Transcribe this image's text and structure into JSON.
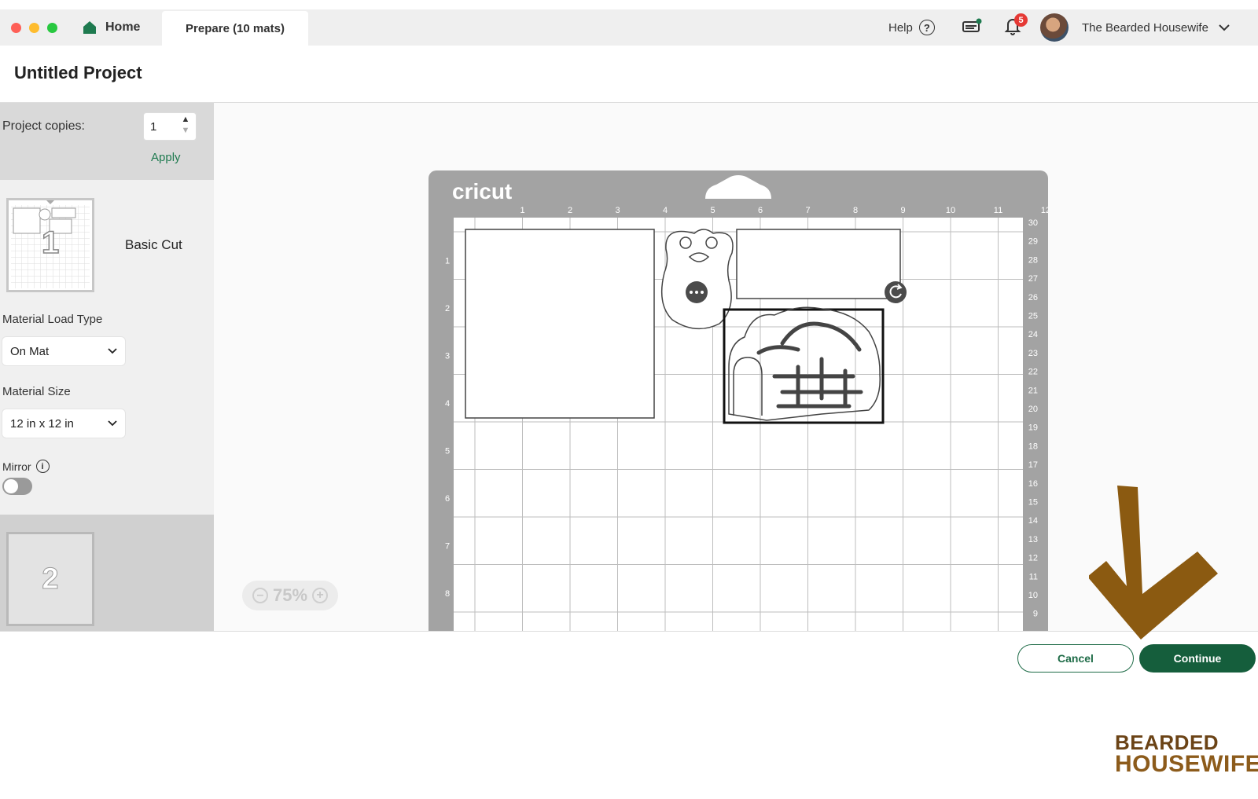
{
  "window": {
    "tabs": [
      {
        "label": "Home",
        "icon": "home-icon"
      },
      {
        "label": "Prepare (10 mats)"
      }
    ],
    "header": {
      "help_label": "Help",
      "help_icon": "?",
      "notification_count": "5",
      "user_name": "The Bearded Housewife"
    }
  },
  "project": {
    "title": "Untitled Project"
  },
  "sidebar": {
    "copies_label": "Project copies:",
    "copies_value": "1",
    "apply_label": "Apply",
    "mat1": {
      "number": "1",
      "label": "Basic Cut"
    },
    "material_load_type_label": "Material Load Type",
    "material_load_type_value": "On Mat",
    "material_size_label": "Material Size",
    "material_size_value": "12 in x 12 in",
    "mirror_label": "Mirror",
    "mirror_on": false,
    "mat2": {
      "number": "2"
    }
  },
  "canvas": {
    "brand_text": "cricut",
    "zoom": "75%",
    "ruler_top": [
      "1",
      "2",
      "3",
      "4",
      "5",
      "6",
      "7",
      "8",
      "9",
      "10",
      "11",
      "12"
    ],
    "ruler_left": [
      "1",
      "2",
      "3",
      "4",
      "5",
      "6",
      "7",
      "8"
    ],
    "ruler_right": [
      "30",
      "29",
      "28",
      "27",
      "26",
      "25",
      "24",
      "23",
      "22",
      "21",
      "20",
      "19",
      "18",
      "17",
      "16",
      "15",
      "14",
      "13",
      "12",
      "11",
      "10",
      "9"
    ]
  },
  "footer": {
    "cancel_label": "Cancel",
    "continue_label": "Continue"
  },
  "watermark": {
    "top": "BEARDED",
    "bottom": "HOUSEWIFE"
  },
  "colors": {
    "accent_green": "#155e3c",
    "apply_green": "#1e7a4f",
    "mat_gray": "#a3a3a3",
    "arrow_brown": "#8b5a11",
    "badge_red": "#e53935"
  }
}
